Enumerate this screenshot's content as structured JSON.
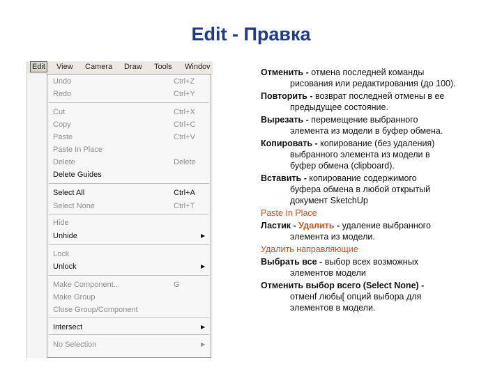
{
  "slide": {
    "title": "Edit - Правка"
  },
  "menubar": {
    "items": [
      "Edit",
      "View",
      "Camera",
      "Draw",
      "Tools",
      "Windov"
    ]
  },
  "menu": {
    "items": [
      {
        "label": "Undo",
        "shortcut": "Ctrl+Z",
        "enabled": false
      },
      {
        "label": "Redo",
        "shortcut": "Ctrl+Y",
        "enabled": false
      },
      {
        "label": "Cut",
        "shortcut": "Ctrl+X",
        "enabled": false
      },
      {
        "label": "Copy",
        "shortcut": "Ctrl+C",
        "enabled": false
      },
      {
        "label": "Paste",
        "shortcut": "Ctrl+V",
        "enabled": false
      },
      {
        "label": "Paste In Place",
        "shortcut": "",
        "enabled": false
      },
      {
        "label": "Delete",
        "shortcut": "Delete",
        "enabled": false
      },
      {
        "label": "Delete Guides",
        "shortcut": "",
        "enabled": true
      },
      {
        "label": "Select All",
        "shortcut": "Ctrl+A",
        "enabled": true
      },
      {
        "label": "Select None",
        "shortcut": "Ctrl+T",
        "enabled": false
      },
      {
        "label": "Hide",
        "shortcut": "",
        "enabled": false
      },
      {
        "label": "Unhide",
        "shortcut": "",
        "enabled": true,
        "submenu": true
      },
      {
        "label": "Lock",
        "shortcut": "",
        "enabled": false
      },
      {
        "label": "Unlock",
        "shortcut": "",
        "enabled": true,
        "submenu": true
      },
      {
        "label": "Make Component...",
        "shortcut": "G",
        "enabled": false
      },
      {
        "label": "Make Group",
        "shortcut": "",
        "enabled": false
      },
      {
        "label": "Close Group/Component",
        "shortcut": "",
        "enabled": false
      },
      {
        "label": "Intersect",
        "shortcut": "",
        "enabled": true,
        "submenu": true
      },
      {
        "label": "No Selection",
        "shortcut": "",
        "enabled": false,
        "submenu": true
      }
    ]
  },
  "descriptions": [
    {
      "term": "Отменить",
      "sep": " - ",
      "line1": "отмена последней команды",
      "cont": [
        "рисования или редактирования (до 100)."
      ]
    },
    {
      "term": "Повторить",
      "sep": " - ",
      "line1": "возврат последней отмены в ее",
      "cont": [
        "предыдущее состояние."
      ]
    },
    {
      "term": "Вырезать",
      "sep": " - ",
      "line1": "перемещение выбранного",
      "cont": [
        "элемента из модели в буфер обмена."
      ]
    },
    {
      "term": "Копировать",
      "sep": " - ",
      "line1": "копирование (без удаления)",
      "cont": [
        "выбранного элемента из модели в",
        "буфер обмена (clipboard)."
      ]
    },
    {
      "term": "Вставить",
      "sep": " - ",
      "line1": "копирование содержимого",
      "cont": [
        "буфера обмена в любой открытый",
        "документ SketchUp"
      ]
    },
    {
      "plain": "Paste In Place",
      "orange": true
    },
    {
      "term": "Ластик -",
      "term_orange": "Удалить",
      "sep": " - ",
      "line1": "удаление выбранного",
      "cont": [
        "элемента из модели."
      ]
    },
    {
      "plain": "Удалить направляющие",
      "orange": true
    },
    {
      "term": "Выбрать все",
      "sep": " - ",
      "line1": "выбор всех возможных",
      "cont": [
        "элементов модели"
      ]
    },
    {
      "term": "Отменить выбор всего (Select None) -",
      "sep": "",
      "line1": "",
      "cont": [
        "отменf любы[ опций выбора для",
        "элементов в модели."
      ]
    }
  ]
}
